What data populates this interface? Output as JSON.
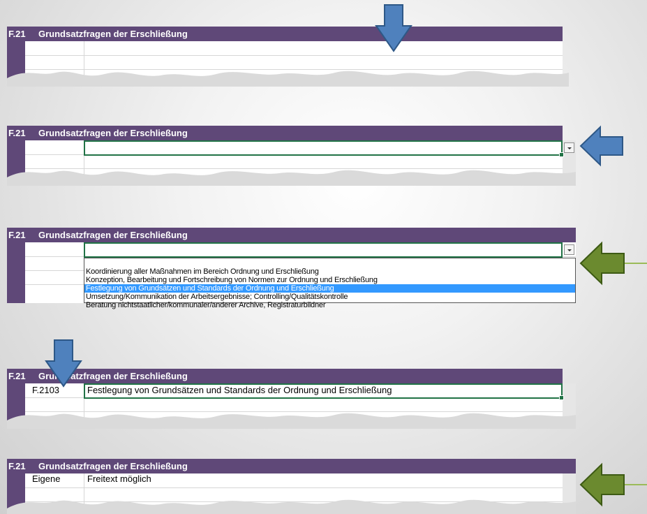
{
  "section": {
    "code": "F.21",
    "title": "Grundsatzfragen der Erschließung"
  },
  "dropdown": {
    "options": [
      "Koordinierung aller Maßnahmen im Bereich Ordnung und Erschließung",
      "Konzeption, Bearbeitung und Fortschreibung von Normen zur Ordnung und Erschließung",
      "Festlegung von Grundsätzen und Standards der Ordnung und Erschließung",
      "Umsetzung/Kommunikation der Arbeitsergebnisse; Controlling/Qualitätskontrolle",
      "Beratung nichtstaatlicher/kommunaler/anderer Archive, Registraturbildner"
    ],
    "highlighted_index": 2
  },
  "selected_row": {
    "code": "F.2103",
    "text": "Festlegung von Grundsätzen und Standards der Ordnung und Erschließung"
  },
  "custom_row": {
    "code": "Eigene",
    "text": "Freitext möglich"
  },
  "colors": {
    "header_bg": "#5f4878",
    "selection_border": "#217346",
    "highlight_bg": "#3399ff",
    "arrow_blue": "#4f81bd",
    "arrow_green": "#6b8a2f"
  },
  "icons": [
    "dropdown-arrow-icon",
    "arrow-down-icon",
    "arrow-left-icon"
  ]
}
